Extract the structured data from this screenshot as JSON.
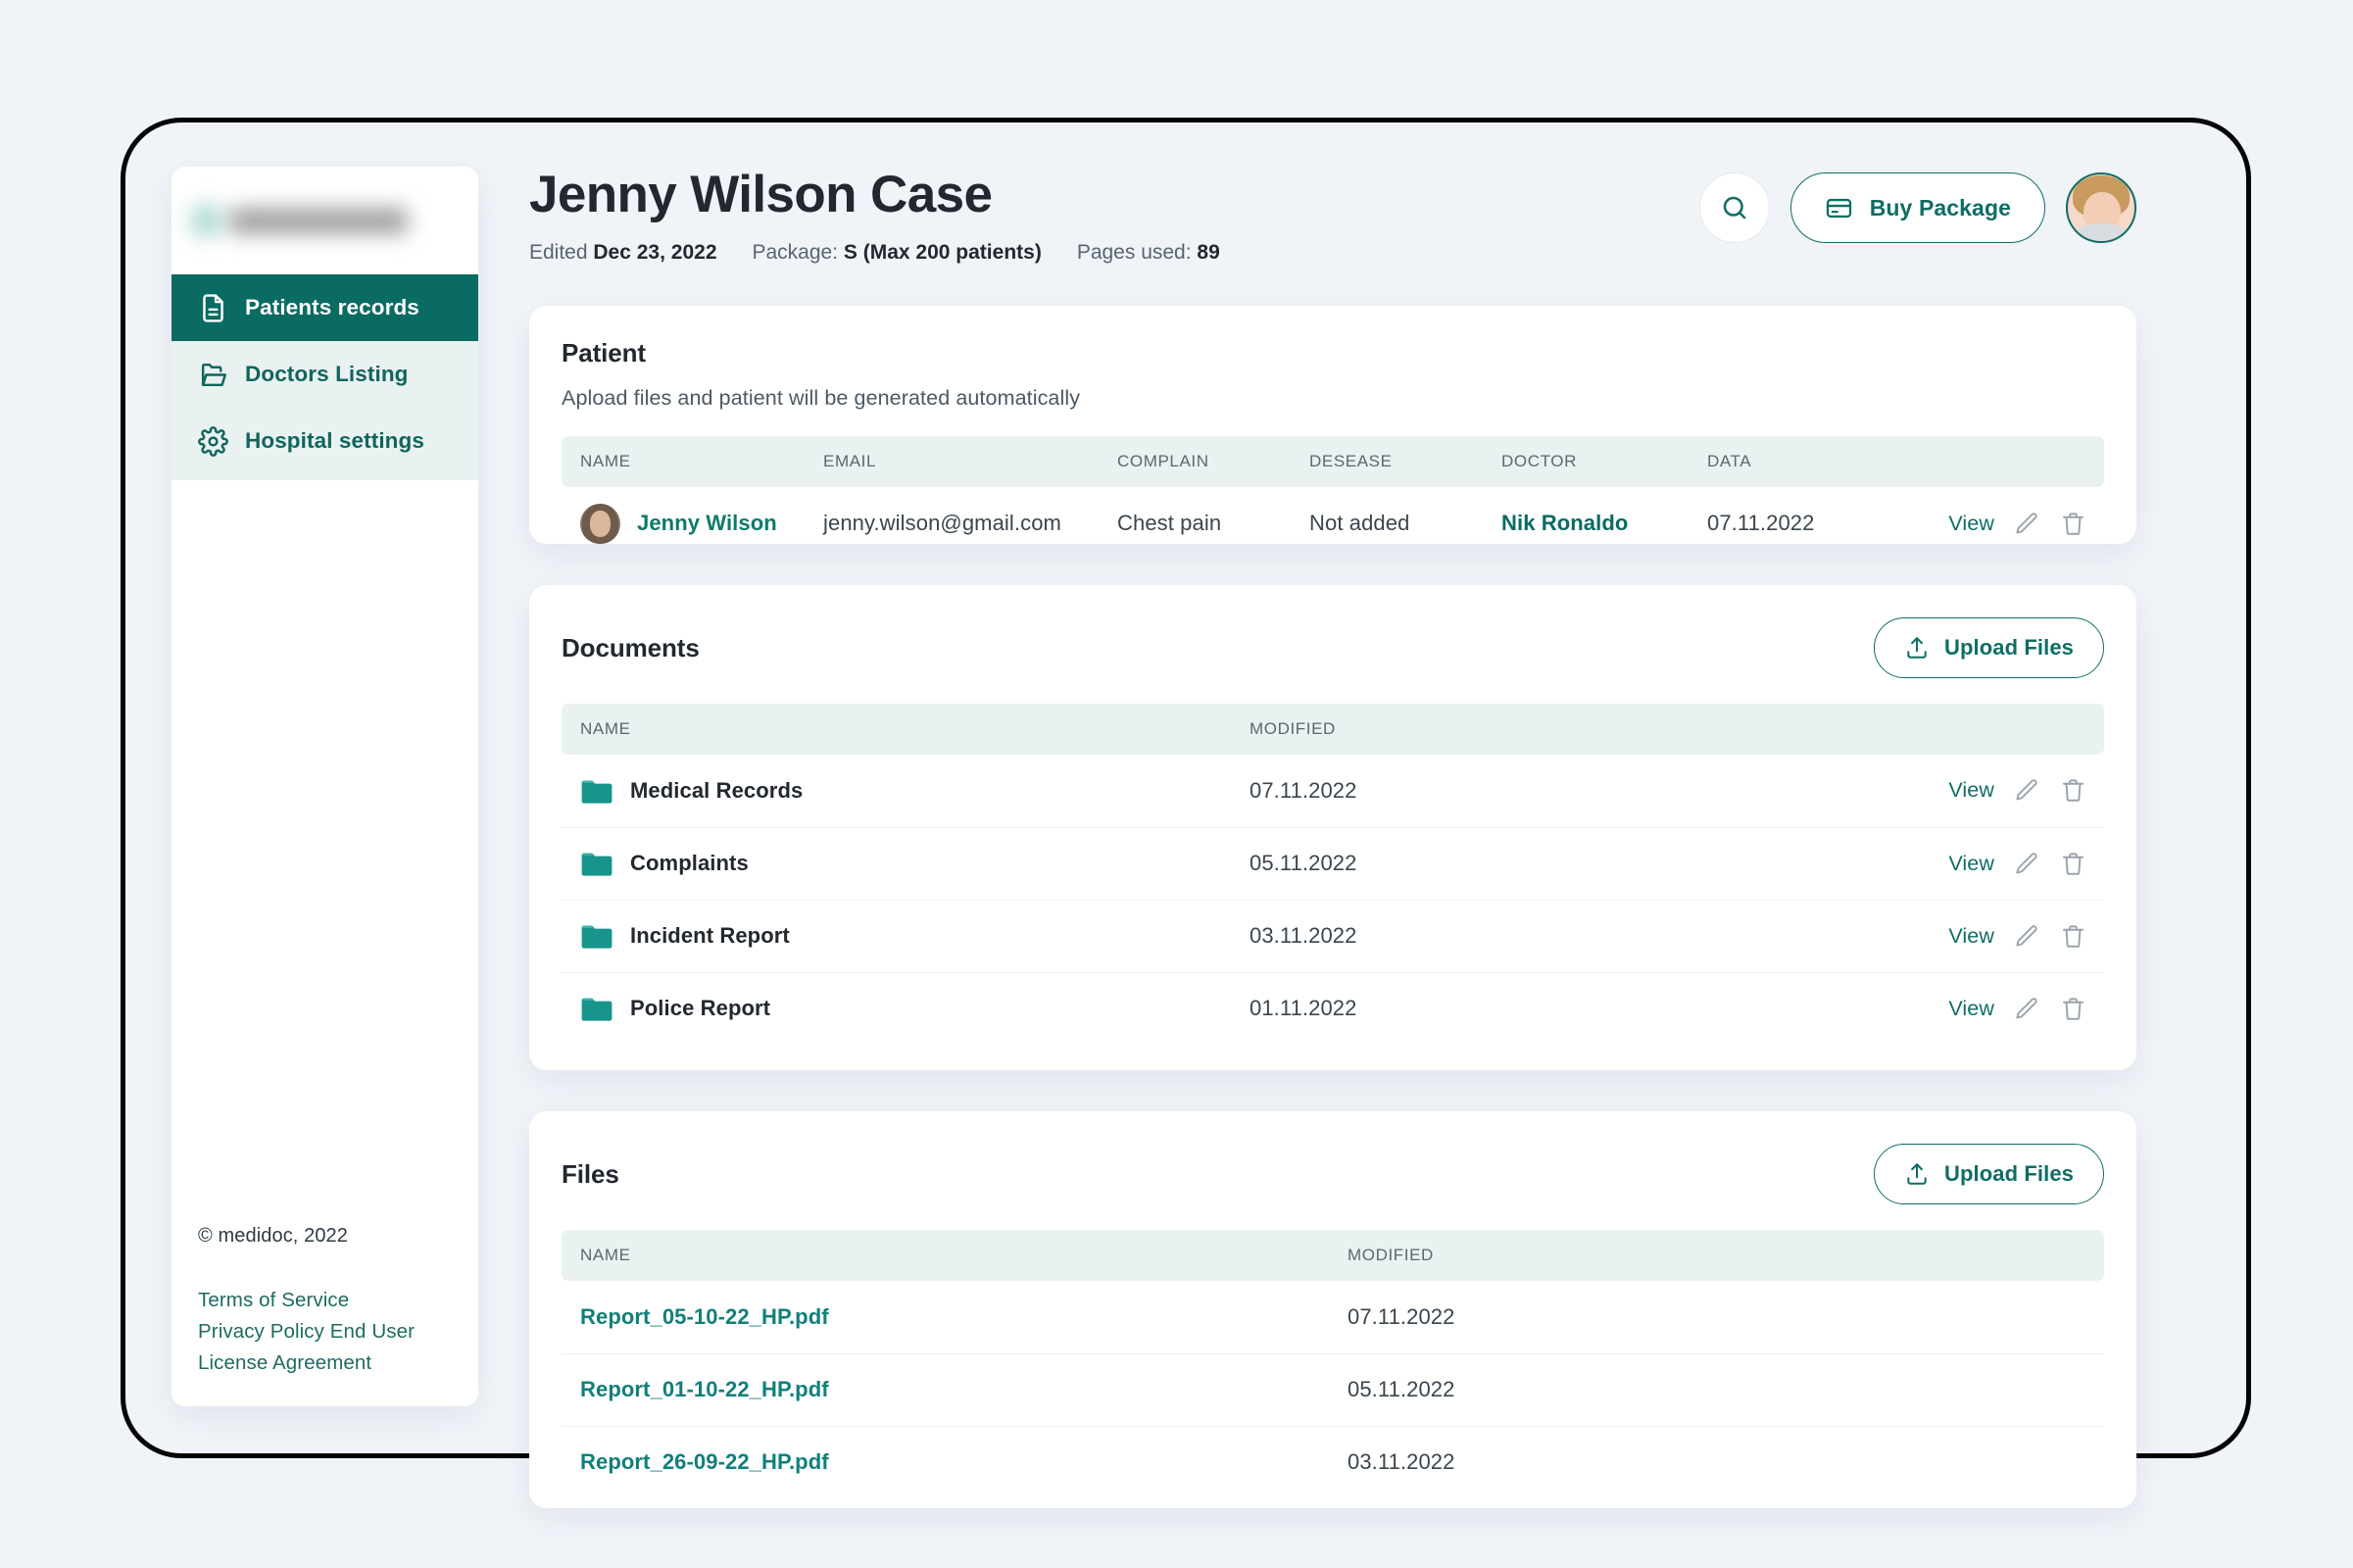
{
  "sidebar": {
    "logo_alt": "medidoc-logo-blurred",
    "items": [
      {
        "label": "Patients records",
        "icon": "document-icon",
        "active": true
      },
      {
        "label": "Doctors Listing",
        "icon": "folder-open-icon",
        "active": false
      },
      {
        "label": "Hospital settings",
        "icon": "gear-icon",
        "active": false
      }
    ],
    "copyright": "© medidoc, 2022",
    "links": [
      "Terms of Service",
      "Privacy Policy End User",
      "License Agreement"
    ]
  },
  "header": {
    "title": "Jenny Wilson Case",
    "meta": {
      "edited_label": "Edited",
      "edited_value": "Dec 23, 2022",
      "package_label": "Package:",
      "package_value": "S (Max 200 patients)",
      "pages_label": "Pages used:",
      "pages_value": "89"
    },
    "search_icon": "search-icon",
    "buy_package_label": "Buy Package",
    "buy_package_icon": "credit-card-icon",
    "avatar_alt": "user-avatar"
  },
  "patient_section": {
    "title": "Patient",
    "subtitle": "Apload files and patient will be generated automatically",
    "columns": [
      "NAME",
      "EMAIL",
      "COMPLAIN",
      "DESEASE",
      "DOCTOR",
      "DATA",
      ""
    ],
    "rows": [
      {
        "name": "Jenny Wilson",
        "email": "jenny.wilson@gmail.com",
        "complain": "Chest pain",
        "desease": "Not added",
        "doctor": "Nik Ronaldo",
        "data": "07.11.2022",
        "view": "View"
      }
    ]
  },
  "documents_section": {
    "title": "Documents",
    "upload_label": "Upload Files",
    "columns": [
      "NAME",
      "MODIFIED",
      ""
    ],
    "rows": [
      {
        "name": "Medical Records",
        "modified": "07.11.2022",
        "view": "View"
      },
      {
        "name": "Complaints",
        "modified": "05.11.2022",
        "view": "View"
      },
      {
        "name": "Incident Report",
        "modified": "03.11.2022",
        "view": "View"
      },
      {
        "name": "Police Report",
        "modified": "01.11.2022",
        "view": "View"
      }
    ]
  },
  "files_section": {
    "title": "Files",
    "upload_label": "Upload Files",
    "columns": [
      "NAME",
      "MODIFIED"
    ],
    "rows": [
      {
        "name": "Report_05-10-22_HP.pdf",
        "modified": "07.11.2022"
      },
      {
        "name": "Report_01-10-22_HP.pdf",
        "modified": "05.11.2022"
      },
      {
        "name": "Report_26-09-22_HP.pdf",
        "modified": "03.11.2022"
      }
    ]
  },
  "colors": {
    "brand_teal": "#0a6b63",
    "link_teal": "#0f6d65",
    "sidebar_tint": "#e9f2f0",
    "page_bg": "#f0f3f8",
    "title_dark": "#232830"
  }
}
